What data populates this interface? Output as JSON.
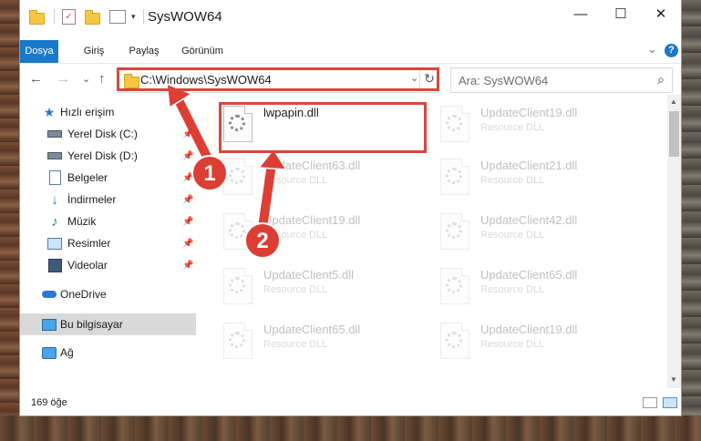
{
  "window": {
    "title": "SysWOW64",
    "minimize_glyph": "—",
    "maximize_glyph": "☐",
    "close_glyph": "✕"
  },
  "ribbon": {
    "tabs": [
      "Dosya",
      "Giriş",
      "Paylaş",
      "Görünüm"
    ],
    "help_glyph": "?",
    "expand_glyph": "⌄"
  },
  "address": {
    "path": "C:\\Windows\\SysWOW64",
    "dropdown_glyph": "⌄",
    "refresh_glyph": "↻"
  },
  "search": {
    "placeholder": "Ara: SysWOW64",
    "icon": "search-icon"
  },
  "nav_glyphs": {
    "back": "←",
    "forward": "→",
    "recent": "⌄",
    "up": "↑"
  },
  "sidebar": {
    "items": [
      {
        "label": "Hızlı erişim",
        "icon": "star-icon"
      },
      {
        "label": "Yerel Disk (C:)",
        "icon": "drive-icon",
        "pinned": true
      },
      {
        "label": "Yerel Disk (D:)",
        "icon": "drive-icon",
        "pinned": true
      },
      {
        "label": "Belgeler",
        "icon": "documents-icon",
        "pinned": true
      },
      {
        "label": "İndirmeler",
        "icon": "download-icon",
        "pinned": true
      },
      {
        "label": "Müzik",
        "icon": "music-icon",
        "pinned": true
      },
      {
        "label": "Resimler",
        "icon": "pictures-icon",
        "pinned": true
      },
      {
        "label": "Videolar",
        "icon": "videos-icon",
        "pinned": true
      },
      {
        "label": "OneDrive",
        "icon": "cloud-icon"
      },
      {
        "label": "Bu bilgisayar",
        "icon": "computer-icon",
        "selected": true
      },
      {
        "label": "Ağ",
        "icon": "network-icon"
      }
    ]
  },
  "files": {
    "highlighted": {
      "name": "lwpapin.dll",
      "type": ""
    },
    "faded": [
      {
        "name": "UpdateClient19.dll",
        "type": "Resource DLL"
      },
      {
        "name": "UpdateClient63.dll",
        "type": "Resource DLL"
      },
      {
        "name": "UpdateClient21.dll",
        "type": "Resource DLL"
      },
      {
        "name": "UpdateClient19.dll",
        "type": "Resource DLL"
      },
      {
        "name": "UpdateClient42.dll",
        "type": "Resource DLL"
      },
      {
        "name": "UpdateClient5.dll",
        "type": "Resource DLL"
      },
      {
        "name": "UpdateClient65.dll",
        "type": "Resource DLL"
      },
      {
        "name": "UpdateClient65.dll",
        "type": "Resource DLL"
      },
      {
        "name": "UpdateClient19.dll",
        "type": "Resource DLL"
      }
    ]
  },
  "status": {
    "count": "169 öğe"
  },
  "annotations": {
    "badge1": "1",
    "badge2": "2",
    "color": "#dc3e34"
  },
  "colors": {
    "accent": "#1979ca",
    "selected_nav": "#d9d9d9"
  }
}
